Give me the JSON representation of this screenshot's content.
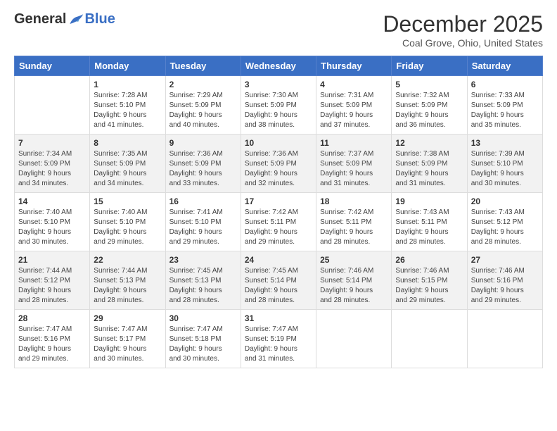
{
  "logo": {
    "general": "General",
    "blue": "Blue"
  },
  "title": "December 2025",
  "location": "Coal Grove, Ohio, United States",
  "days_of_week": [
    "Sunday",
    "Monday",
    "Tuesday",
    "Wednesday",
    "Thursday",
    "Friday",
    "Saturday"
  ],
  "weeks": [
    [
      {
        "day": "",
        "info": ""
      },
      {
        "day": "1",
        "info": "Sunrise: 7:28 AM\nSunset: 5:10 PM\nDaylight: 9 hours\nand 41 minutes."
      },
      {
        "day": "2",
        "info": "Sunrise: 7:29 AM\nSunset: 5:09 PM\nDaylight: 9 hours\nand 40 minutes."
      },
      {
        "day": "3",
        "info": "Sunrise: 7:30 AM\nSunset: 5:09 PM\nDaylight: 9 hours\nand 38 minutes."
      },
      {
        "day": "4",
        "info": "Sunrise: 7:31 AM\nSunset: 5:09 PM\nDaylight: 9 hours\nand 37 minutes."
      },
      {
        "day": "5",
        "info": "Sunrise: 7:32 AM\nSunset: 5:09 PM\nDaylight: 9 hours\nand 36 minutes."
      },
      {
        "day": "6",
        "info": "Sunrise: 7:33 AM\nSunset: 5:09 PM\nDaylight: 9 hours\nand 35 minutes."
      }
    ],
    [
      {
        "day": "7",
        "info": "Sunrise: 7:34 AM\nSunset: 5:09 PM\nDaylight: 9 hours\nand 34 minutes."
      },
      {
        "day": "8",
        "info": "Sunrise: 7:35 AM\nSunset: 5:09 PM\nDaylight: 9 hours\nand 34 minutes."
      },
      {
        "day": "9",
        "info": "Sunrise: 7:36 AM\nSunset: 5:09 PM\nDaylight: 9 hours\nand 33 minutes."
      },
      {
        "day": "10",
        "info": "Sunrise: 7:36 AM\nSunset: 5:09 PM\nDaylight: 9 hours\nand 32 minutes."
      },
      {
        "day": "11",
        "info": "Sunrise: 7:37 AM\nSunset: 5:09 PM\nDaylight: 9 hours\nand 31 minutes."
      },
      {
        "day": "12",
        "info": "Sunrise: 7:38 AM\nSunset: 5:09 PM\nDaylight: 9 hours\nand 31 minutes."
      },
      {
        "day": "13",
        "info": "Sunrise: 7:39 AM\nSunset: 5:10 PM\nDaylight: 9 hours\nand 30 minutes."
      }
    ],
    [
      {
        "day": "14",
        "info": "Sunrise: 7:40 AM\nSunset: 5:10 PM\nDaylight: 9 hours\nand 30 minutes."
      },
      {
        "day": "15",
        "info": "Sunrise: 7:40 AM\nSunset: 5:10 PM\nDaylight: 9 hours\nand 29 minutes."
      },
      {
        "day": "16",
        "info": "Sunrise: 7:41 AM\nSunset: 5:10 PM\nDaylight: 9 hours\nand 29 minutes."
      },
      {
        "day": "17",
        "info": "Sunrise: 7:42 AM\nSunset: 5:11 PM\nDaylight: 9 hours\nand 29 minutes."
      },
      {
        "day": "18",
        "info": "Sunrise: 7:42 AM\nSunset: 5:11 PM\nDaylight: 9 hours\nand 28 minutes."
      },
      {
        "day": "19",
        "info": "Sunrise: 7:43 AM\nSunset: 5:11 PM\nDaylight: 9 hours\nand 28 minutes."
      },
      {
        "day": "20",
        "info": "Sunrise: 7:43 AM\nSunset: 5:12 PM\nDaylight: 9 hours\nand 28 minutes."
      }
    ],
    [
      {
        "day": "21",
        "info": "Sunrise: 7:44 AM\nSunset: 5:12 PM\nDaylight: 9 hours\nand 28 minutes."
      },
      {
        "day": "22",
        "info": "Sunrise: 7:44 AM\nSunset: 5:13 PM\nDaylight: 9 hours\nand 28 minutes."
      },
      {
        "day": "23",
        "info": "Sunrise: 7:45 AM\nSunset: 5:13 PM\nDaylight: 9 hours\nand 28 minutes."
      },
      {
        "day": "24",
        "info": "Sunrise: 7:45 AM\nSunset: 5:14 PM\nDaylight: 9 hours\nand 28 minutes."
      },
      {
        "day": "25",
        "info": "Sunrise: 7:46 AM\nSunset: 5:14 PM\nDaylight: 9 hours\nand 28 minutes."
      },
      {
        "day": "26",
        "info": "Sunrise: 7:46 AM\nSunset: 5:15 PM\nDaylight: 9 hours\nand 29 minutes."
      },
      {
        "day": "27",
        "info": "Sunrise: 7:46 AM\nSunset: 5:16 PM\nDaylight: 9 hours\nand 29 minutes."
      }
    ],
    [
      {
        "day": "28",
        "info": "Sunrise: 7:47 AM\nSunset: 5:16 PM\nDaylight: 9 hours\nand 29 minutes."
      },
      {
        "day": "29",
        "info": "Sunrise: 7:47 AM\nSunset: 5:17 PM\nDaylight: 9 hours\nand 30 minutes."
      },
      {
        "day": "30",
        "info": "Sunrise: 7:47 AM\nSunset: 5:18 PM\nDaylight: 9 hours\nand 30 minutes."
      },
      {
        "day": "31",
        "info": "Sunrise: 7:47 AM\nSunset: 5:19 PM\nDaylight: 9 hours\nand 31 minutes."
      },
      {
        "day": "",
        "info": ""
      },
      {
        "day": "",
        "info": ""
      },
      {
        "day": "",
        "info": ""
      }
    ]
  ]
}
